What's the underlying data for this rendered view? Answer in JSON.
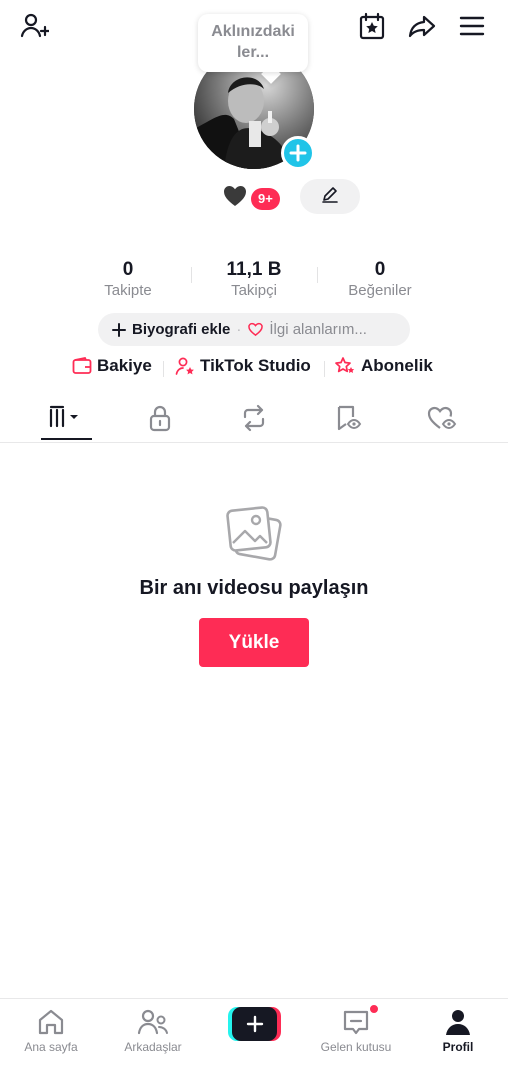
{
  "top_bar": {
    "add_friend_icon": "person-plus-icon",
    "calendar_icon": "calendar-star-icon",
    "share_icon": "share-arrow-icon",
    "menu_icon": "hamburger-menu-icon"
  },
  "profile": {
    "bubble_text": "Aklınızdaki ler...",
    "avatar_icon": "avatar-photo",
    "badge_count": "9+",
    "heart_icon": "black-heart-icon",
    "edit_icon": "pencil-icon"
  },
  "stats": {
    "following_count": "0",
    "following_label": "Takipte",
    "followers_count": "11,1 B",
    "followers_label": "Takipçi",
    "likes_count": "0",
    "likes_label": "Beğeniler"
  },
  "bio": {
    "add_bio_label": "Biyografi ekle",
    "interests_label": "İlgi alanlarım..."
  },
  "links": {
    "balance_label": "Bakiye",
    "studio_label": "TikTok Studio",
    "subscription_label": "Abonelik"
  },
  "tabs": [
    {
      "icon": "videos-grid-icon",
      "active": true
    },
    {
      "icon": "lock-icon",
      "active": false
    },
    {
      "icon": "repost-icon",
      "active": false
    },
    {
      "icon": "bookmark-eye-icon",
      "active": false
    },
    {
      "icon": "liked-heart-eye-icon",
      "active": false
    }
  ],
  "empty_state": {
    "icon": "photos-icon",
    "title": "Bir anı videosu paylaşın",
    "upload_label": "Yükle"
  },
  "bottom_nav": {
    "home_label": "Ana sayfa",
    "friends_label": "Arkadaşlar",
    "inbox_label": "Gelen kutusu",
    "profile_label": "Profil"
  },
  "colors": {
    "accent": "#fe2c55",
    "cyan": "#25f4ee",
    "text": "#161823",
    "muted": "#8a8b91"
  }
}
